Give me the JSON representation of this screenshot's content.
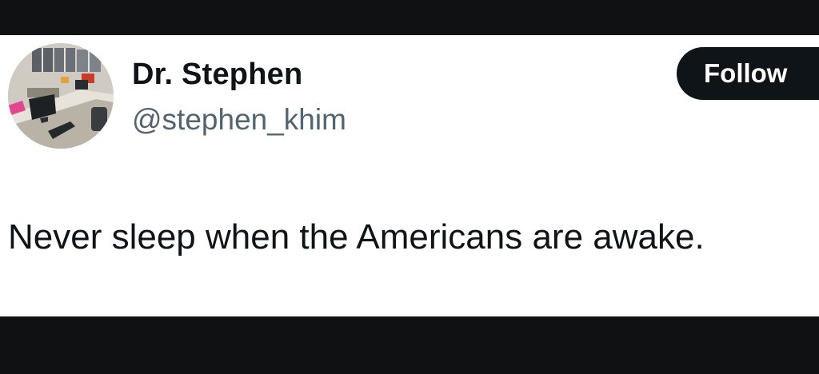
{
  "tweet": {
    "author": {
      "display_name": "Dr. Stephen",
      "handle": "@stephen_khim",
      "avatar_icon": "office-desk-photo"
    },
    "follow_label": "Follow",
    "text": "Never sleep when the Americans are awake."
  },
  "colors": {
    "background_dark": "#0f1113",
    "card_background": "#ffffff",
    "primary_text": "#0f1419",
    "secondary_text": "#536471",
    "follow_button": "#0f1419"
  }
}
